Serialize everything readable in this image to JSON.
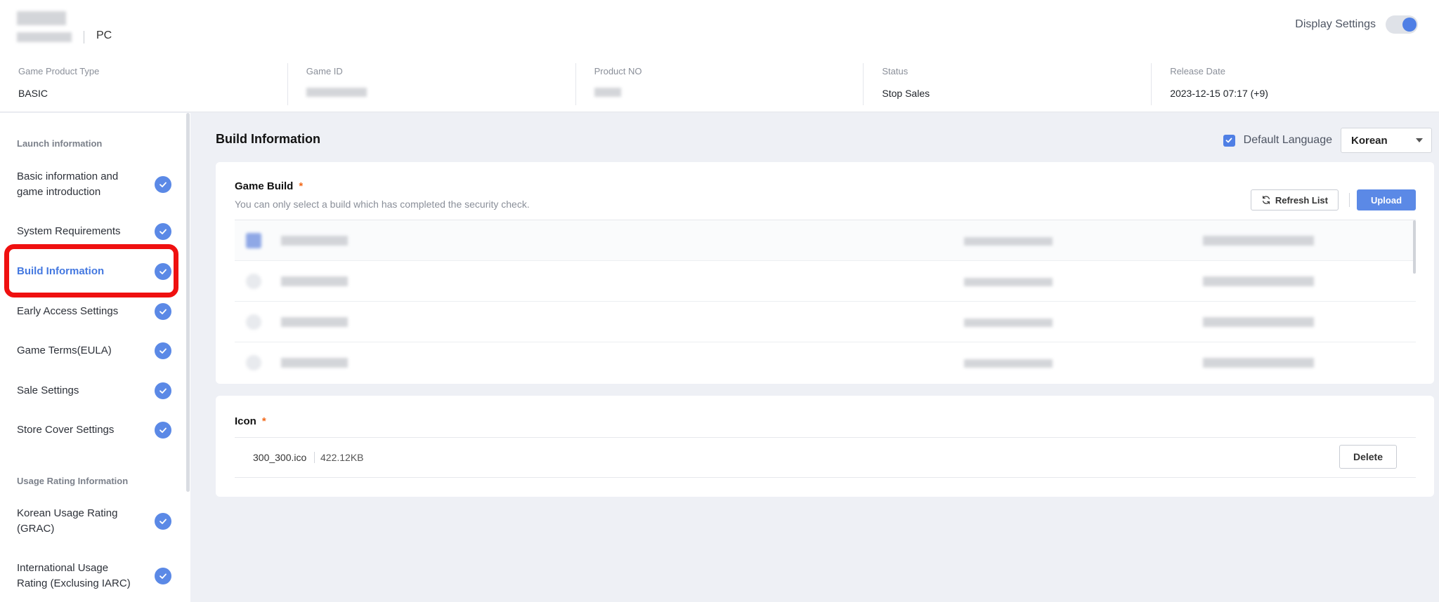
{
  "header": {
    "platform": "PC",
    "display_settings_label": "Display Settings",
    "display_settings_on": true
  },
  "meta": [
    {
      "label": "Game Product Type",
      "value": "BASIC"
    },
    {
      "label": "Game ID",
      "value": ""
    },
    {
      "label": "Product NO",
      "value": ""
    },
    {
      "label": "Status",
      "value": "Stop Sales"
    },
    {
      "label": "Release Date",
      "value": "2023-12-15 07:17 (+9)"
    }
  ],
  "sidebar": {
    "sections": [
      {
        "title": "Launch information"
      },
      {
        "title": "Usage Rating Information"
      }
    ],
    "items": [
      {
        "label": "Basic information and game introduction"
      },
      {
        "label": "System Requirements"
      },
      {
        "label": "Build Information"
      },
      {
        "label": "Early Access Settings"
      },
      {
        "label": "Game Terms(EULA)"
      },
      {
        "label": "Sale Settings"
      },
      {
        "label": "Store Cover Settings"
      },
      {
        "label": "Korean Usage Rating (GRAC)"
      },
      {
        "label": "International Usage Rating (Exclusing IARC)"
      }
    ],
    "active_item": "Build Information"
  },
  "main": {
    "title": "Build Information",
    "default_language_label": "Default Language",
    "default_language_checked": true,
    "language_selected": "Korean"
  },
  "game_build": {
    "title": "Game Build",
    "required_mark": "*",
    "hint": "You can only select a build which has completed the security check.",
    "refresh_label": "Refresh List",
    "upload_label": "Upload",
    "rows": 4
  },
  "icon_section": {
    "title": "Icon",
    "required_mark": "*",
    "file_name": "300_300.ico",
    "file_size": "422.12KB",
    "delete_label": "Delete"
  },
  "colors": {
    "accent": "#5b89e6",
    "highlight": "#ef1010",
    "required": "#f26a1b"
  }
}
